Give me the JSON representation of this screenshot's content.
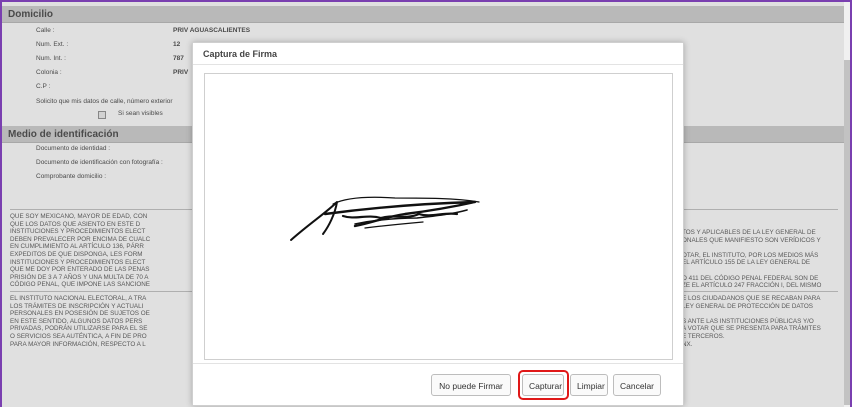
{
  "domicilio": {
    "header": "Domicilio",
    "fields": [
      {
        "label": "Calle :",
        "value": "PRIV AGUASCALIENTES"
      },
      {
        "label": "Num. Ext. :",
        "value": "12"
      },
      {
        "label": "Num. Int. :",
        "value": "787"
      },
      {
        "label": "Colonia :",
        "value": "PRIV"
      },
      {
        "label": "C.P :",
        "value": ""
      }
    ],
    "privacy_prompt": "Solicito que mis datos de calle, número exterior",
    "visible_checkbox_label": "Si sean visibles"
  },
  "identificacion": {
    "header": "Medio de identificación",
    "fields": [
      {
        "label": "Documento de identidad :"
      },
      {
        "label": "Documento de identificación con fotografía :"
      },
      {
        "label": "Comprobante domicilio :"
      }
    ]
  },
  "legal": {
    "p1_left": [
      "QUE SOY MEXICANO, MAYOR DE EDAD, CON",
      "QUE LOS DATOS QUE ASIENTO EN ESTE D",
      "INSTITUCIONES Y PROCEDIMIENTOS ELECT",
      "DEBEN PREVALECER POR ENCIMA DE CUALC",
      "EN CUMPLIMIENTO AL ARTÍCULO 136, PÁRR",
      "EXPEDITOS DE QUE DISPONGA, LES FORM",
      "INSTITUCIONES Y PROCEDIMIENTOS ELECT",
      "QUE ME DOY POR ENTERADO DE LAS PENAS",
      "PRISIÓN DE 3 A 7 AÑOS Y UNA MULTA DE 70 A",
      "CÓDIGO PENAL, QUE IMPONE LAS SANCIONE"
    ],
    "p1_right": [
      "TOS Y APLICABLES DE LA LEY GENERAL DE",
      "ONALES QUE MANIFIESTO SON VERÍDICOS Y",
      "",
      "OTAR, EL INSTITUTO, POR LOS MEDIOS MÁS",
      "EL ARTÍCULO 155 DE LA LEY GENERAL DE",
      "",
      "O 411 DEL CÓDIGO PENAL FEDERAL SON DE",
      "ZE EL ARTÍCULO 247 FRACCIÓN I, DEL MISMO"
    ],
    "p2_left": [
      "EL INSTITUTO NACIONAL ELECTORAL, A TRA",
      "LOS TRÁMITES DE INSCRIPCIÓN Y ACTUALI",
      "PERSONALES EN POSESIÓN DE SUJETOS OE",
      "EN ESTE SENTIDO, ALGUNOS DATOS PERS",
      "PRIVADAS, PODRÁN UTILIZARSE PARA EL SE",
      "O SERVICIOS SEA AUTÉNTICA, A FIN DE PRO",
      "PARA MAYOR INFORMACIÓN, RESPECTO A L"
    ],
    "p2_right": [
      "E LOS CIUDADANOS QUE SE RECABAN PARA",
      "LEY GENERAL DE PROTECCIÓN DE DATOS",
      "",
      "S ANTE LAS INSTITUCIONES PÚBLICAS Y/O",
      "A VOTAR QUE SE PRESENTA PARA TRÁMITES",
      "E TERCEROS.",
      "nx."
    ]
  },
  "modal": {
    "title": "Captura de Firma",
    "buttons": {
      "cannot_sign": "No puede Firmar",
      "capture": "Capturar",
      "clear": "Limpiar",
      "cancel": "Cancelar"
    },
    "highlight_color": "#e01818"
  }
}
